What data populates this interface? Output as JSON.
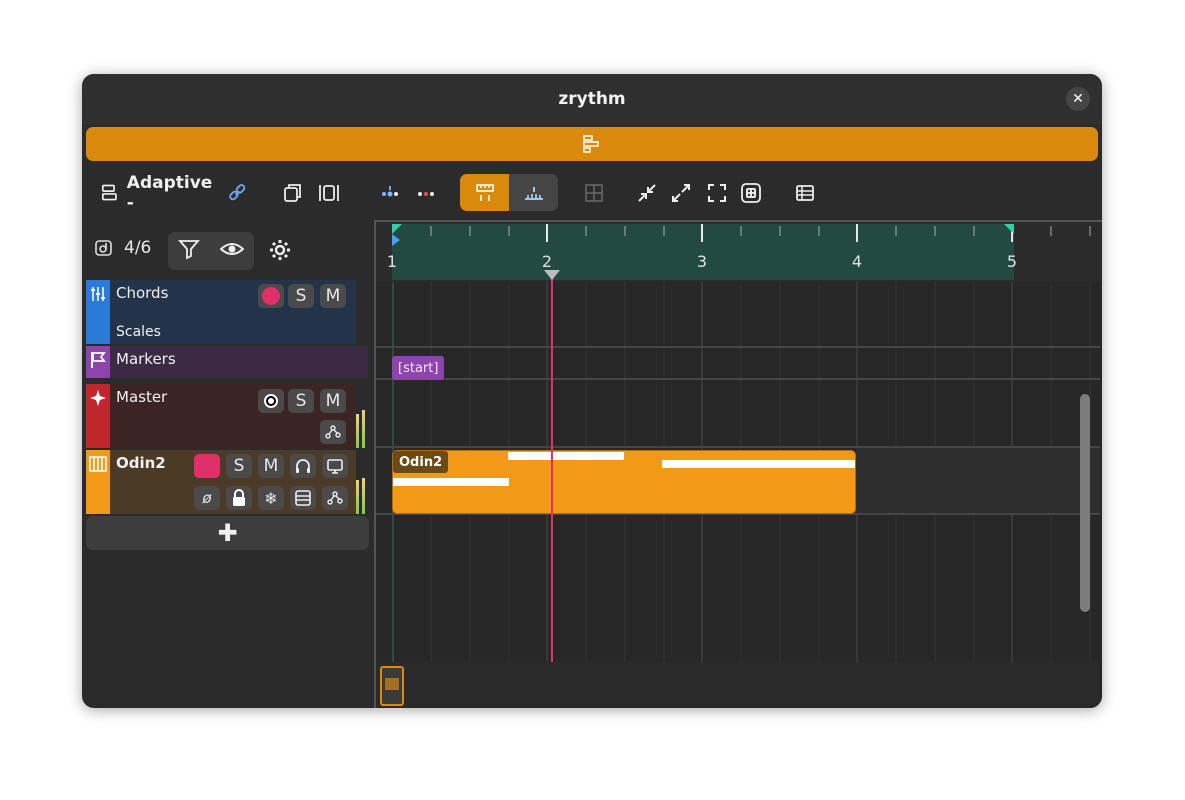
{
  "window": {
    "title": "zrythm"
  },
  "toolbar": {
    "layout_label": "Adaptive -"
  },
  "tracklist": {
    "track_count": "4/6"
  },
  "tracks": [
    {
      "name": "Chords",
      "sub": "Scales",
      "color": "#2a7ad8",
      "solo": "S",
      "mute": "M"
    },
    {
      "name": "Markers",
      "color": "#8e44ad"
    },
    {
      "name": "Master",
      "color": "#c0272d",
      "solo": "S",
      "mute": "M"
    },
    {
      "name": "Odin2",
      "color": "#f29a17",
      "solo": "S",
      "mute": "M",
      "phase": "ø"
    }
  ],
  "ruler": {
    "bars": [
      "1",
      "2",
      "3",
      "4",
      "5"
    ]
  },
  "markers": [
    {
      "label": "[start]"
    }
  ],
  "regions": [
    {
      "label": "Odin2",
      "color": "#f29a17"
    }
  ],
  "colors": {
    "accent": "#d98a0c",
    "playhead": "#e0306a",
    "loop": "#234a42"
  },
  "icons": {
    "close": "close-icon",
    "layout": "layout-icon",
    "link": "link-icon",
    "duplicate": "duplicate-icon",
    "split": "split-icon",
    "snap": "snap-icon",
    "grid": "grid-icon",
    "shrink": "shrink-icon",
    "expand": "expand-icon",
    "fullscreen": "fullscreen-icon",
    "dice": "dice-icon",
    "table": "table-icon",
    "filter": "filter-icon",
    "eye": "eye-icon",
    "gear": "gear-icon",
    "add": "plus-icon"
  }
}
